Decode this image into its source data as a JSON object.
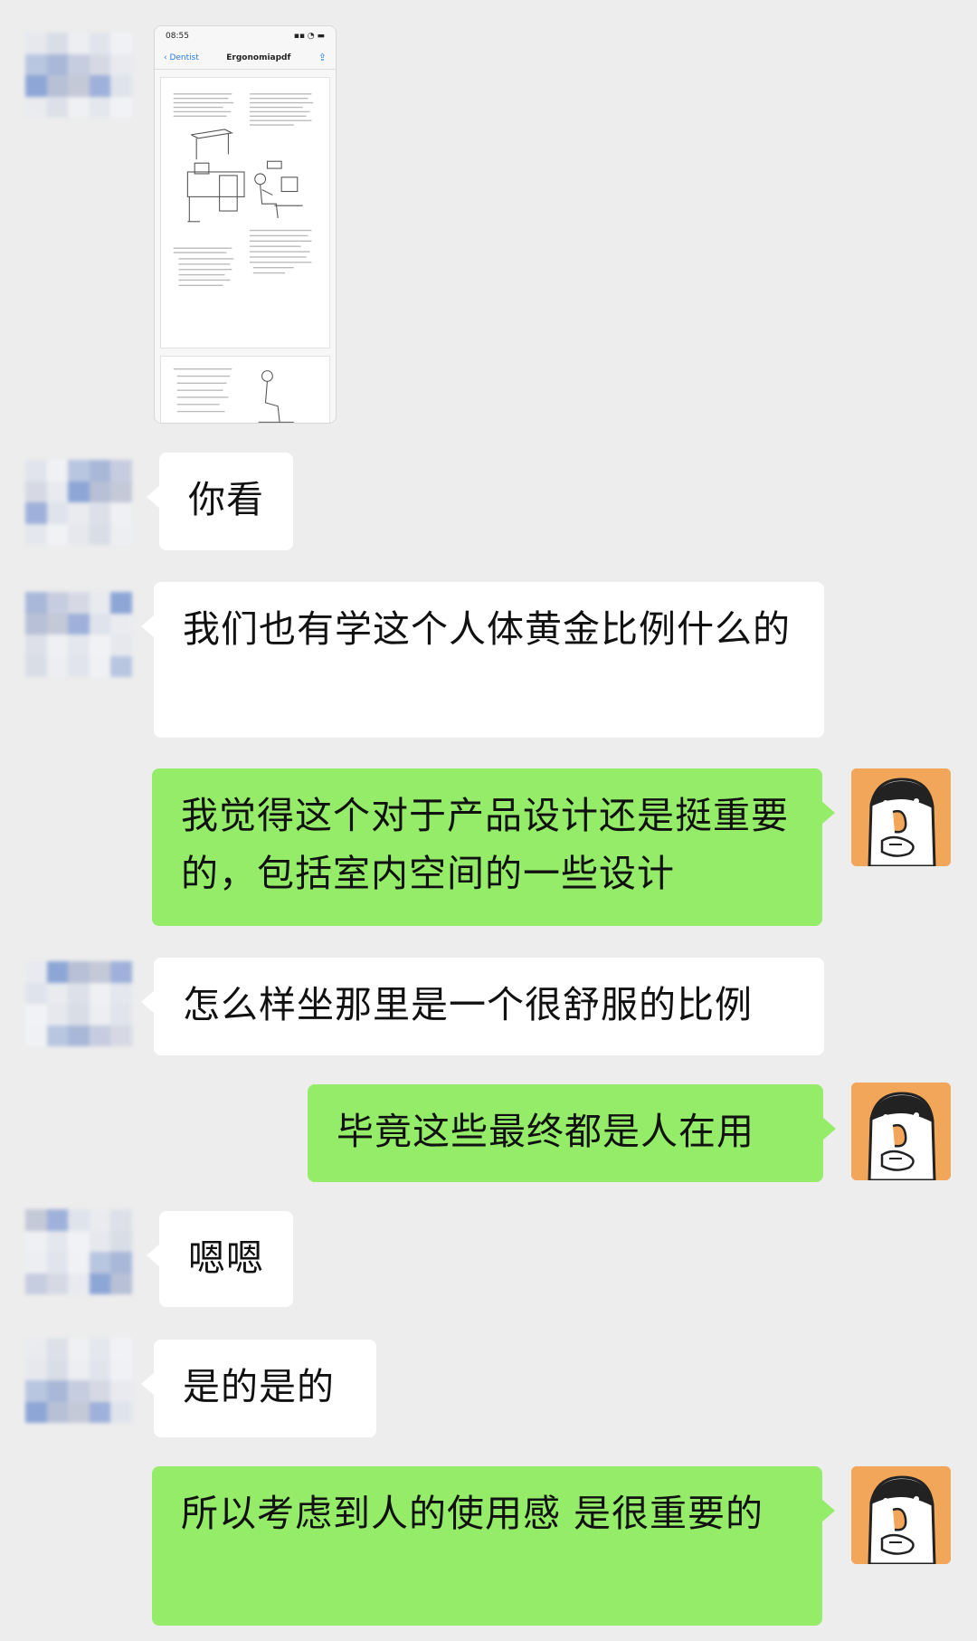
{
  "image_message": {
    "status_time": "08:55",
    "nav_back": "Dentist",
    "nav_title": "Ergonomiapdf"
  },
  "messages": [
    {
      "side": "left",
      "text": "你看"
    },
    {
      "side": "left",
      "text": "我们也有学这个人体黄金比例什么的"
    },
    {
      "side": "right",
      "text": "我觉得这个对于产品设计还是挺重要的，包括室内空间的一些设计"
    },
    {
      "side": "left",
      "text": "怎么样坐那里是一个很舒服的比例"
    },
    {
      "side": "right",
      "text": "毕竟这些最终都是人在用"
    },
    {
      "side": "left",
      "text": "嗯嗯"
    },
    {
      "side": "left",
      "text": "是的是的"
    },
    {
      "side": "right",
      "text": "所以考虑到人的使用感  是很重要的"
    }
  ],
  "colors": {
    "background": "#ededed",
    "bubble_self": "#95ec69",
    "bubble_other": "#ffffff"
  }
}
